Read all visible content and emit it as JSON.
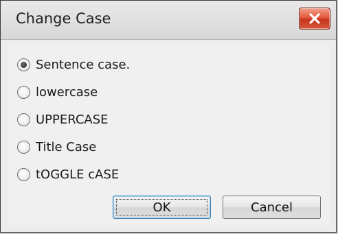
{
  "window": {
    "title": "Change Case",
    "close_icon": "close-icon"
  },
  "options": [
    {
      "label": "Sentence case.",
      "checked": true
    },
    {
      "label": "lowercase",
      "checked": false
    },
    {
      "label": "UPPERCASE",
      "checked": false
    },
    {
      "label": "Title Case",
      "checked": false
    },
    {
      "label": "tOGGLE cASE",
      "checked": false
    }
  ],
  "buttons": {
    "ok": "OK",
    "cancel": "Cancel"
  },
  "colors": {
    "close_button": "#d9472b"
  }
}
